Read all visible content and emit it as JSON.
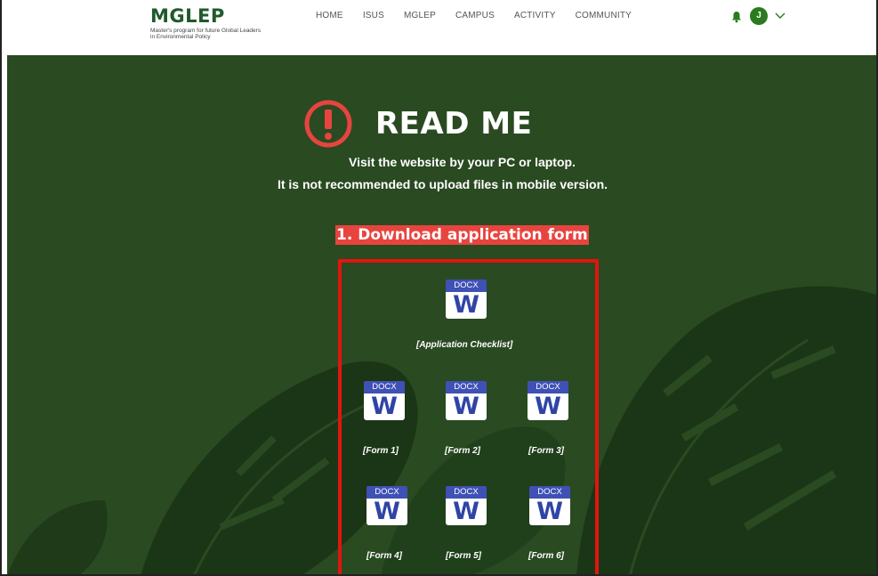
{
  "header": {
    "logo_title": "MGLEP",
    "logo_subtitle": "Master's program for future Global Leaders in Environmental Policy",
    "nav": [
      "HOME",
      "ISUS",
      "MGLEP",
      "CAMPUS",
      "ACTIVITY",
      "COMMUNITY"
    ],
    "avatar_initial": "J"
  },
  "main": {
    "readme_title": "READ ME",
    "notice_line1": "Visit the website by your PC or laptop.",
    "notice_line2": "It is not recommended to upload files in mobile version.",
    "section_title": "1. Download application form",
    "files": [
      {
        "type": "DOCX",
        "glyph": "W",
        "label": "[Application Checklist]"
      },
      {
        "type": "DOCX",
        "glyph": "W",
        "label": "[Form 1]"
      },
      {
        "type": "DOCX",
        "glyph": "W",
        "label": "[Form 2]"
      },
      {
        "type": "DOCX",
        "glyph": "W",
        "label": "[Form 3]"
      },
      {
        "type": "DOCX",
        "glyph": "W",
        "label": "[Form 4]"
      },
      {
        "type": "DOCX",
        "glyph": "W",
        "label": "[Form 5]"
      },
      {
        "type": "DOCX",
        "glyph": "W",
        "label": "[Form 6]"
      }
    ]
  },
  "colors": {
    "brand_green": "#1f5a2c",
    "background_green": "#2a4a21",
    "alert_red": "#e8443f",
    "docx_blue": "#3f51b5"
  },
  "icons": [
    "bell-icon",
    "avatar",
    "chevron-down-icon",
    "warning-icon",
    "word-docx-icon"
  ]
}
